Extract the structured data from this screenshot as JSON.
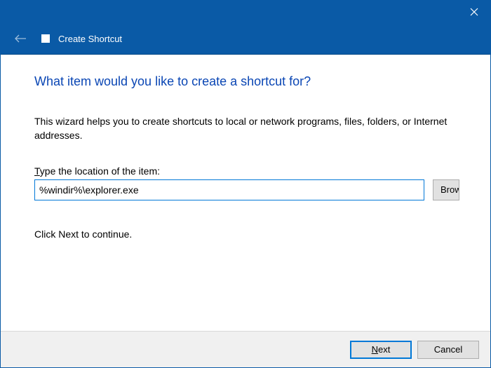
{
  "colors": {
    "accent": "#0a5aa6",
    "heading": "#0a46b4",
    "button_bg": "#e1e1e1"
  },
  "titlebar": {
    "close": "Close"
  },
  "header": {
    "title": "Create Shortcut"
  },
  "main": {
    "heading": "What item would you like to create a shortcut for?",
    "description": "This wizard helps you to create shortcuts to local or network programs, files, folders, or Internet addresses.",
    "location_label_pre": "T",
    "location_label_rest": "ype the location of the item:",
    "location_value": "%windir%\\explorer.exe",
    "browse_label": "Browse...",
    "continue_hint": "Click Next to continue."
  },
  "footer": {
    "next_underline": "N",
    "next_rest": "ext",
    "cancel": "Cancel"
  }
}
